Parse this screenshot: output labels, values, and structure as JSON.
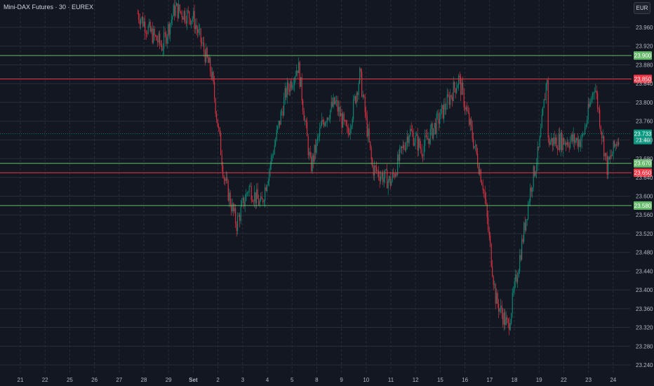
{
  "header": {
    "title": "Mini-DAX Futures · 30 · EUREX",
    "currency_button": "EUR"
  },
  "chart_data": {
    "type": "candlestick",
    "title": "Mini-DAX Futures · 30 · EUREX",
    "ylim": [
      23220,
      24000
    ],
    "y_ticks": [
      "23.960",
      "23.920",
      "23.880",
      "23.840",
      "23.800",
      "23.760",
      "23.720",
      "23.680",
      "23.640",
      "23.600",
      "23.560",
      "23.520",
      "23.480",
      "23.440",
      "23.400",
      "23.360",
      "23.320",
      "23.280",
      "23.240"
    ],
    "x_ticks": [
      "21",
      "22",
      "25",
      "26",
      "27",
      "28",
      "29",
      "Set",
      "2",
      "3",
      "4",
      "5",
      "8",
      "9",
      "10",
      "11",
      "12",
      "15",
      "16",
      "17",
      "18",
      "19",
      "22",
      "23",
      "24"
    ],
    "grid": true,
    "horizontal_lines": [
      {
        "value": 23900,
        "label": "23.900",
        "color": "#66bb6a"
      },
      {
        "value": 23850,
        "label": "23.850",
        "color": "#f23645"
      },
      {
        "value": 23670,
        "label": "23.670",
        "color": "#66bb6a"
      },
      {
        "value": 23650,
        "label": "23.650",
        "color": "#f23645"
      },
      {
        "value": 23580,
        "label": "23.580",
        "color": "#66bb6a"
      }
    ],
    "last_price": {
      "value": 23733,
      "label": "23.733",
      "countdown": "21:40",
      "color": "#089981"
    },
    "price_path": [
      {
        "x": "28",
        "y": 23990
      },
      {
        "x": "28",
        "y": 23950
      },
      {
        "x": "29",
        "y": 23920
      },
      {
        "x": "29",
        "y": 24000
      },
      {
        "x": "Set",
        "y": 23980
      },
      {
        "x": "2",
        "y": 23860
      },
      {
        "x": "2",
        "y": 23640
      },
      {
        "x": "3",
        "y": 23540
      },
      {
        "x": "3",
        "y": 23620
      },
      {
        "x": "4",
        "y": 23580
      },
      {
        "x": "4",
        "y": 23700
      },
      {
        "x": "5",
        "y": 23820
      },
      {
        "x": "5",
        "y": 23880
      },
      {
        "x": "8",
        "y": 23660
      },
      {
        "x": "8",
        "y": 23760
      },
      {
        "x": "9",
        "y": 23800
      },
      {
        "x": "9",
        "y": 23730
      },
      {
        "x": "10",
        "y": 23860
      },
      {
        "x": "10",
        "y": 23660
      },
      {
        "x": "11",
        "y": 23630
      },
      {
        "x": "12",
        "y": 23740
      },
      {
        "x": "12",
        "y": 23700
      },
      {
        "x": "15",
        "y": 23770
      },
      {
        "x": "16",
        "y": 23850
      },
      {
        "x": "16",
        "y": 23740
      },
      {
        "x": "17",
        "y": 23620
      },
      {
        "x": "17",
        "y": 23380
      },
      {
        "x": "18",
        "y": 23320
      },
      {
        "x": "18",
        "y": 23480
      },
      {
        "x": "19",
        "y": 23620
      },
      {
        "x": "19",
        "y": 23700
      },
      {
        "x": "19",
        "y": 23860
      },
      {
        "x": "22",
        "y": 23780
      },
      {
        "x": "22",
        "y": 23590
      },
      {
        "x": "22",
        "y": 23670
      },
      {
        "x": "23",
        "y": 23720
      },
      {
        "x": "23",
        "y": 23840
      },
      {
        "x": "24",
        "y": 23660
      },
      {
        "x": "24",
        "y": 23733
      }
    ],
    "colors": {
      "up": "#089981",
      "down": "#f23645",
      "background": "#131722",
      "grid": "#2a2e39",
      "axis_text": "#b2b5be"
    }
  }
}
